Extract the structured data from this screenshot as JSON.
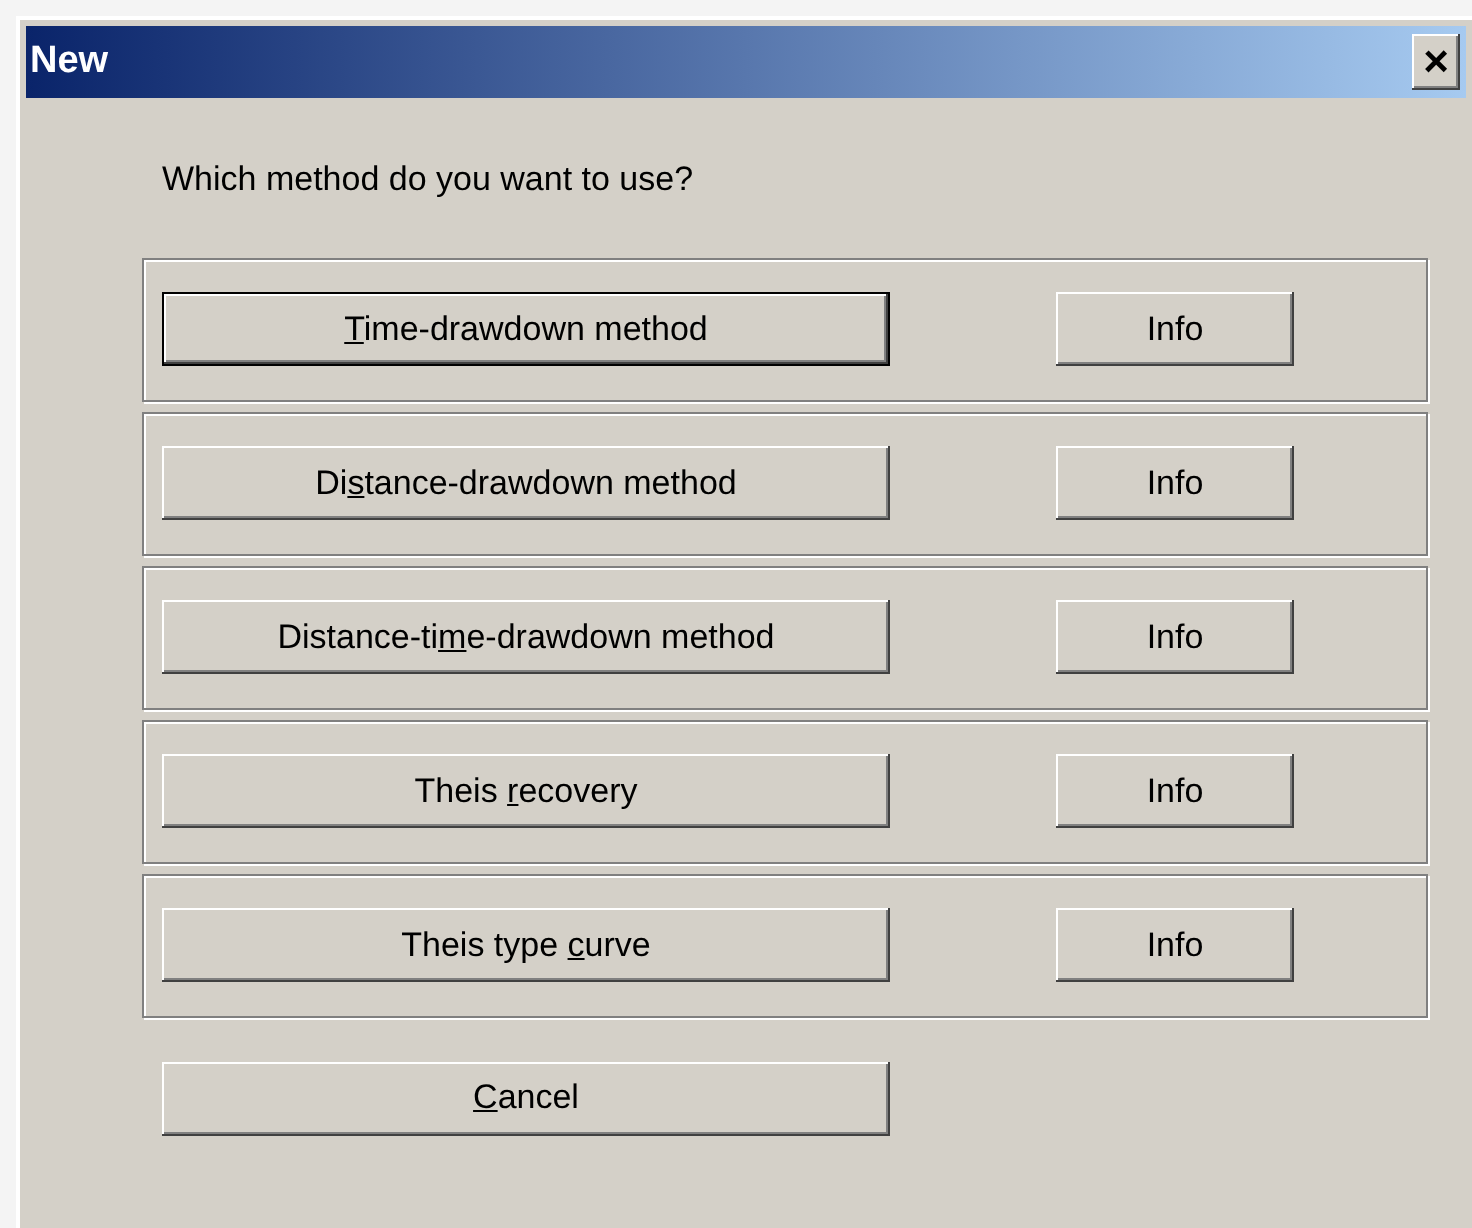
{
  "window": {
    "title": "New",
    "close_glyph": "×"
  },
  "prompt": "Which method do you want to use?",
  "methods": [
    {
      "key": "T",
      "after": "ime-drawdown method",
      "default": true,
      "info": "Info"
    },
    {
      "before": "Di",
      "key": "s",
      "after": "tance-drawdown method",
      "default": false,
      "info": "Info"
    },
    {
      "before": "Distance-ti",
      "key": "m",
      "after": "e-drawdown method",
      "default": false,
      "info": "Info"
    },
    {
      "before": "Theis ",
      "key": "r",
      "after": "ecovery",
      "default": false,
      "info": "Info"
    },
    {
      "before": "Theis type ",
      "key": "c",
      "after": "urve",
      "default": false,
      "info": "Info"
    }
  ],
  "cancel": {
    "key": "C",
    "after": "ancel",
    "default": false
  }
}
